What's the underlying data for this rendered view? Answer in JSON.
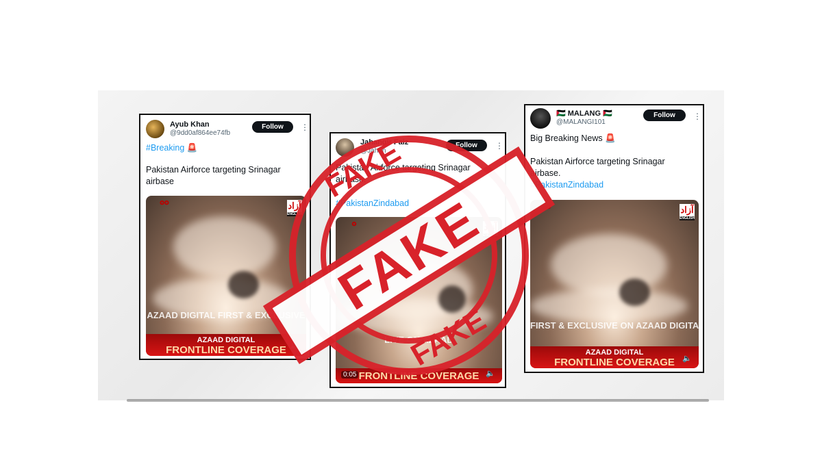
{
  "tweets": [
    {
      "name": "Ayub Khan",
      "handle": "@9dd0af864ee74fb",
      "follow": "Follow",
      "more": "⋮",
      "hashtag": "#Breaking",
      "emoji": "🚨",
      "body": "Pakistan Airforce targeting Srinagar airbase",
      "video_overlay": "AZAAD DIGITAL FIRST & EXCLUSIVE",
      "banner_line1": "AZAAD DIGITAL",
      "banner_line2": "FRONTLINE COVERAGE"
    },
    {
      "name": "Jahangir Faiz",
      "handle": "@Jahan",
      "follow": "Follow",
      "more": "⋮",
      "body": "Pakistan Airforce targeting Srinagar airbase.",
      "hashtag": "#PakistanZindabad",
      "video_overlay": "LIVE ON AZAAD",
      "time": "0:05",
      "banner_line2": "FRONTLINE COVERAGE"
    },
    {
      "name": "MALANG",
      "flag": "🇵🇸",
      "handle": "@MALANGI101",
      "follow": "Follow",
      "more": "⋮",
      "headline": "Big Breaking News",
      "emoji": "🚨",
      "body": "Pakistan Airforce targeting Srinagar airbase.",
      "hashtag": "#PakistanZindabad",
      "video_overlay": "FIRST & EXCLUSIVE ON AZAAD DIGITAL",
      "banner_line1": "AZAAD DIGITAL",
      "banner_line2": "FRONTLINE COVERAGE"
    }
  ],
  "stamp": {
    "word": "FAKE",
    "color": "#d8222a"
  },
  "colors": {
    "link": "#1d9bf0",
    "follow_bg": "#0f1419",
    "banner": "#c80f0f"
  }
}
